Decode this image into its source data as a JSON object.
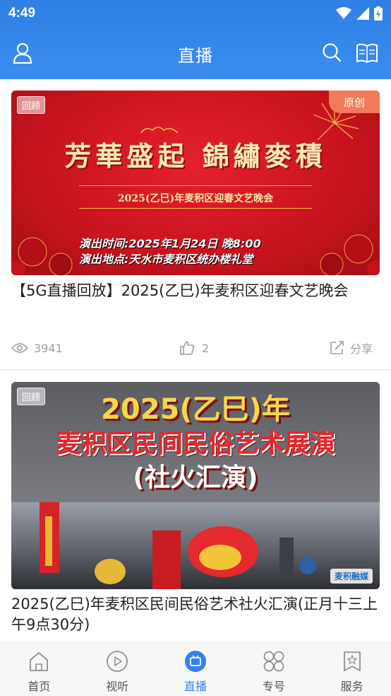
{
  "status_bar": {
    "time": "4:49"
  },
  "header": {
    "title": "直播"
  },
  "cards": [
    {
      "tag_replay": "回顾",
      "tag_original": "原创",
      "poster_title": "芳華盛起  錦繡麥積",
      "poster_subtitle": "2025(乙巳)年麦积区迎春文艺晚会",
      "poster_time": "演出时间:2025年1月24日 晚8:00",
      "poster_place": "演出地点:天水市麦积区统办楼礼堂",
      "title": "【5G直播回放】2025(乙巳)年麦积区迎春文艺晚会",
      "views": "3941",
      "likes": "2",
      "share_label": "分享"
    },
    {
      "tag_replay": "回顾",
      "poster_line1": "2025(乙巳)年",
      "poster_line2": "麦积区民间民俗艺术展演",
      "poster_line3": "(社火汇演)",
      "watermark": "麦积融媒",
      "title": "2025(乙巳)年麦积区民间民俗艺术社火汇演(正月十三上午9点30分)"
    }
  ],
  "tabs": [
    {
      "label": "首页",
      "icon": "home-icon"
    },
    {
      "label": "视听",
      "icon": "play-icon"
    },
    {
      "label": "直播",
      "icon": "live-icon",
      "active": true
    },
    {
      "label": "专号",
      "icon": "circles-icon"
    },
    {
      "label": "服务",
      "icon": "star-bookmark-icon"
    }
  ],
  "colors": {
    "brand": "#2f82ec",
    "poster_red": "#d0161f",
    "original_tag": "#f07a5a"
  }
}
